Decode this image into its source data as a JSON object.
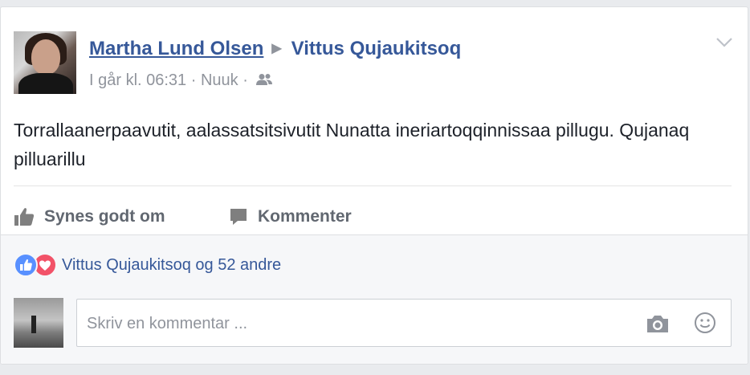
{
  "post": {
    "author": "Martha Lund Olsen",
    "target": "Vittus Qujaukitsoq",
    "timestamp": "I går kl. 06:31",
    "separator": "·",
    "location": "Nuuk",
    "audience_icon": "friends-icon",
    "text": "Torrallaanerpaavutit, aalassatsitsivutit Nunatta ineriartoqqinnissaa pillugu. Qujanaq pilluarillu"
  },
  "actions": {
    "like_label": "Synes godt om",
    "comment_label": "Kommenter"
  },
  "reactions": {
    "text": "Vittus Qujaukitsoq og 52 andre",
    "types": [
      "like",
      "love"
    ]
  },
  "comment_input": {
    "placeholder": "Skriv en kommentar ..."
  },
  "colors": {
    "link": "#365899",
    "muted": "#90949c",
    "like": "#5890ff",
    "love": "#f25268"
  }
}
